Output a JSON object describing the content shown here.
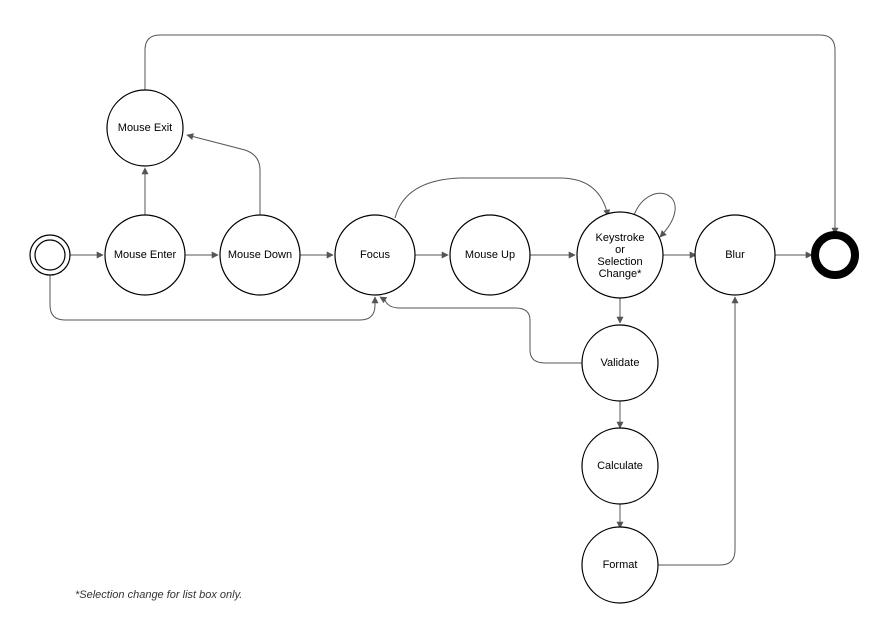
{
  "diagram": {
    "nodes": {
      "start": {
        "kind": "start"
      },
      "mouse_enter": {
        "label": "Mouse Enter"
      },
      "mouse_exit": {
        "label": "Mouse Exit"
      },
      "mouse_down": {
        "label": "Mouse Down"
      },
      "focus": {
        "label": "Focus"
      },
      "mouse_up": {
        "label": "Mouse Up"
      },
      "keystroke": {
        "label": "Keystroke or Selection Change*",
        "lines": [
          "Keystroke",
          "or",
          "Selection",
          "Change*"
        ]
      },
      "validate": {
        "label": "Validate"
      },
      "calculate": {
        "label": "Calculate"
      },
      "format": {
        "label": "Format"
      },
      "blur": {
        "label": "Blur"
      },
      "end": {
        "kind": "end"
      }
    },
    "edges": [
      {
        "from": "start",
        "to": "mouse_enter"
      },
      {
        "from": "mouse_enter",
        "to": "mouse_down"
      },
      {
        "from": "mouse_enter",
        "to": "mouse_exit"
      },
      {
        "from": "mouse_down",
        "to": "mouse_exit"
      },
      {
        "from": "mouse_exit",
        "to": "end"
      },
      {
        "from": "mouse_down",
        "to": "focus"
      },
      {
        "from": "start",
        "to": "focus"
      },
      {
        "from": "focus",
        "to": "mouse_up"
      },
      {
        "from": "focus",
        "to": "keystroke"
      },
      {
        "from": "mouse_up",
        "to": "keystroke"
      },
      {
        "from": "keystroke",
        "to": "keystroke"
      },
      {
        "from": "keystroke",
        "to": "blur"
      },
      {
        "from": "keystroke",
        "to": "validate"
      },
      {
        "from": "validate",
        "to": "calculate"
      },
      {
        "from": "validate",
        "to": "focus"
      },
      {
        "from": "calculate",
        "to": "format"
      },
      {
        "from": "format",
        "to": "blur"
      },
      {
        "from": "blur",
        "to": "end"
      }
    ],
    "footnote": "*Selection change for list box only."
  }
}
